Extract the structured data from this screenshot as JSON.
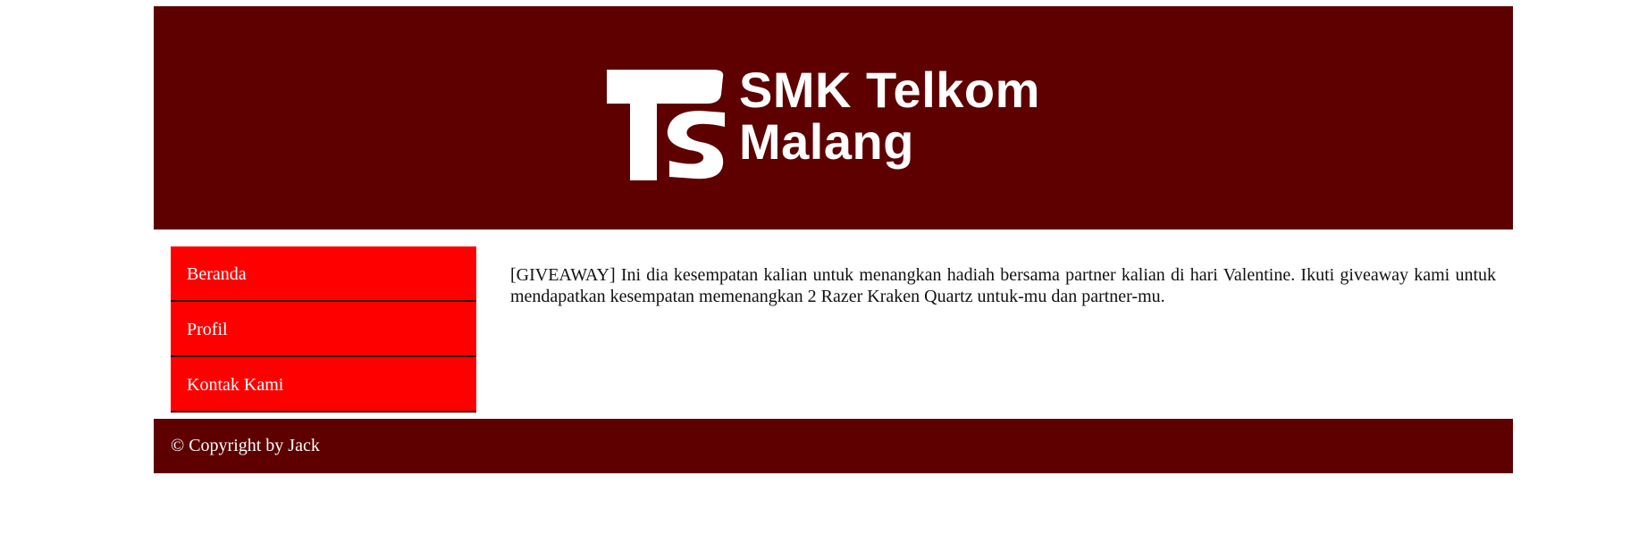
{
  "header": {
    "logo_line1": "SMK Telkom",
    "logo_line2": "Malang"
  },
  "sidebar": {
    "items": [
      {
        "label": "Beranda"
      },
      {
        "label": "Profil"
      },
      {
        "label": "Kontak Kami"
      }
    ]
  },
  "main": {
    "text": "[GIVEAWAY] Ini dia kesempatan kalian untuk menangkan hadiah bersama partner kalian di hari Valentine. Ikuti giveaway kami untuk mendapatkan kesempatan memenangkan 2 Razer Kraken Quartz untuk-mu dan partner-mu."
  },
  "footer": {
    "copyright": "© Copyright by Jack"
  },
  "colors": {
    "header_bg": "#5e0000",
    "nav_bg": "#ff0000",
    "footer_bg": "#5e0000",
    "text_light": "#ffffff"
  }
}
